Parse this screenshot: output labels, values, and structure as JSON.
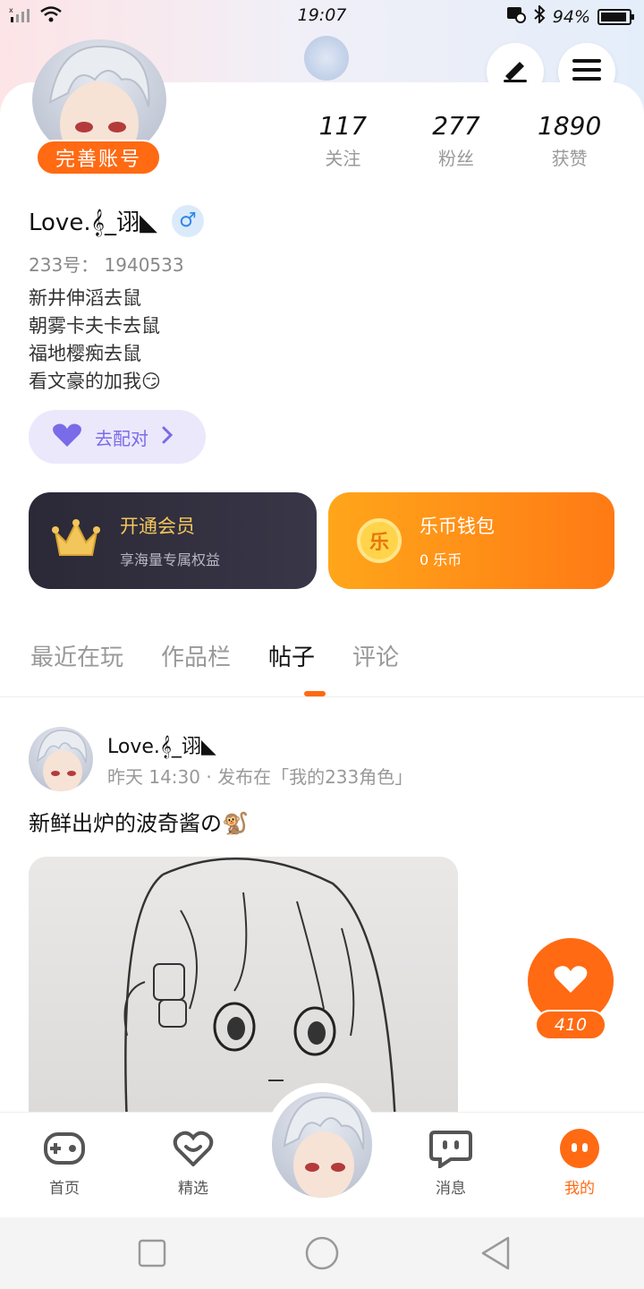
{
  "status_bar": {
    "time": "19:07",
    "battery": "94%",
    "battery_level": 0.94,
    "left_icons": [
      "signal-icon",
      "wifi-icon"
    ],
    "right_icons": [
      "message-icon",
      "bluetooth-icon",
      "battery-icon"
    ]
  },
  "header": {
    "complete_account_label": "完善账号",
    "edit_icon": "pen-icon",
    "menu_icon": "hamburger-icon"
  },
  "stats": [
    {
      "value": "117",
      "label": "关注"
    },
    {
      "value": "277",
      "label": "粉丝"
    },
    {
      "value": "1890",
      "label": "获赞"
    }
  ],
  "profile": {
    "username": "Love.𝄞_诩◣",
    "gender_symbol": "♂",
    "uid": "233号： 1940533",
    "bio": [
      "新井伸滔去鼠",
      "朝雾卡夫卡去鼠",
      "福地樱痴去鼠",
      "看文豪的加我😏"
    ],
    "match_label": "去配对"
  },
  "cards": {
    "vip": {
      "title": "开通会员",
      "subtitle": "享海量专属权益"
    },
    "wallet": {
      "title": "乐币钱包",
      "subtitle": "0 乐币",
      "coin_glyph": "乐"
    }
  },
  "tabs": [
    {
      "label": "最近在玩",
      "active": false
    },
    {
      "label": "作品栏",
      "active": false
    },
    {
      "label": "帖子",
      "active": true
    },
    {
      "label": "评论",
      "active": false
    }
  ],
  "post": {
    "author": "Love.𝄞_诩◣",
    "meta": "昨天 14:30 · 发布在「我的233角色」",
    "text": "新鲜出炉的波奇酱の🐒",
    "likes": "410"
  },
  "bottom_nav": [
    {
      "label": "首页",
      "icon": "gamepad-icon",
      "active": false
    },
    {
      "label": "精选",
      "icon": "heart-chat-icon",
      "active": false
    },
    {
      "label": "消息",
      "icon": "chat-bubble-icon",
      "active": false
    },
    {
      "label": "我的",
      "icon": "profile-dots-icon",
      "active": true
    }
  ],
  "colors": {
    "accent": "#ff6a13",
    "match_purple": "#7a6be8",
    "vip_gold": "#f3c65b"
  }
}
